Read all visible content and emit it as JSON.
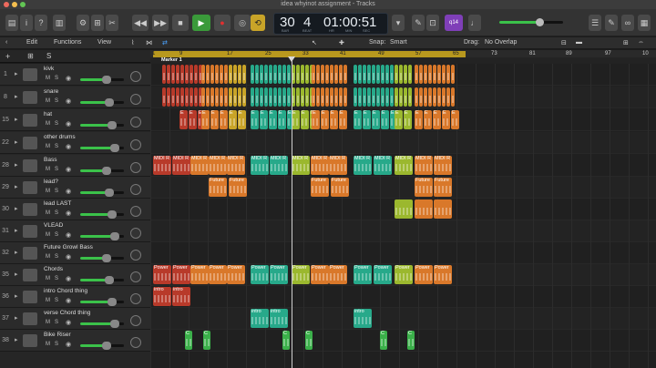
{
  "window": {
    "title": "idea whyinot assignment - Tracks"
  },
  "transport": {
    "bar": "30",
    "beat": "4",
    "bar_label": "BAR",
    "beat_label": "BEAT",
    "time": "01:00:51",
    "hr_label": "HR",
    "min_label": "MIN",
    "sec_label": "SEC"
  },
  "badge": "q14",
  "menubar": {
    "edit": "Edit",
    "functions": "Functions",
    "view": "View",
    "snap_label": "Snap:",
    "snap_value": "Smart",
    "drag_label": "Drag:",
    "drag_value": "No Overlap"
  },
  "header": {
    "add": "+",
    "s_button": "S"
  },
  "ruler": {
    "ticks": [
      "1",
      "9",
      "17",
      "25",
      "33",
      "41",
      "49",
      "57",
      "65",
      "73",
      "81",
      "89",
      "97",
      "10"
    ],
    "marker": "Marker 1"
  },
  "tracks": [
    {
      "num": "1",
      "name": "kivk",
      "mute": "M",
      "solo": "S",
      "icon": "drum-machine-icon"
    },
    {
      "num": "8",
      "name": "snare",
      "mute": "M",
      "solo": "S",
      "icon": "drum-machine-icon"
    },
    {
      "num": "15",
      "name": "hat",
      "mute": "M",
      "solo": "S",
      "icon": "drum-machine-icon"
    },
    {
      "num": "22",
      "name": "other drums",
      "mute": "M",
      "solo": "S",
      "icon": "drum-machine-icon"
    },
    {
      "num": "28",
      "name": "Bass",
      "mute": "M",
      "solo": "S",
      "icon": "synth-icon"
    },
    {
      "num": "29",
      "name": "lead?",
      "mute": "M",
      "solo": "S",
      "icon": "synth-icon"
    },
    {
      "num": "30",
      "name": "lead LAST",
      "mute": "M",
      "solo": "S",
      "icon": "synth-icon"
    },
    {
      "num": "31",
      "name": "VLEAD",
      "mute": "M",
      "solo": "S",
      "icon": "synth-icon"
    },
    {
      "num": "32",
      "name": "Future Growl Bass",
      "mute": "M",
      "solo": "S",
      "icon": "synth-icon"
    },
    {
      "num": "35",
      "name": "Chords",
      "mute": "M",
      "solo": "S",
      "icon": "synth-icon"
    },
    {
      "num": "36",
      "name": "intro Chord thing",
      "mute": "M",
      "solo": "S",
      "icon": "keyboard-icon"
    },
    {
      "num": "37",
      "name": "verse Chord thing",
      "mute": "M",
      "solo": "S",
      "icon": "keyboard-icon"
    },
    {
      "num": "38",
      "name": "Bike Riser",
      "mute": "M",
      "solo": "S",
      "icon": "synth-icon"
    }
  ],
  "region_labels": {
    "midi": "MIDI R",
    "future": "Future",
    "power": "Power",
    "intro": "intro",
    "c": "C",
    "e": "E"
  },
  "colors": {
    "red": "#b83a2a",
    "orange": "#d9782a",
    "yellow": "#c9a428",
    "lime": "#9bb82e",
    "teal": "#27a98a",
    "green": "#3bb04a",
    "accent": "#b8981e"
  }
}
